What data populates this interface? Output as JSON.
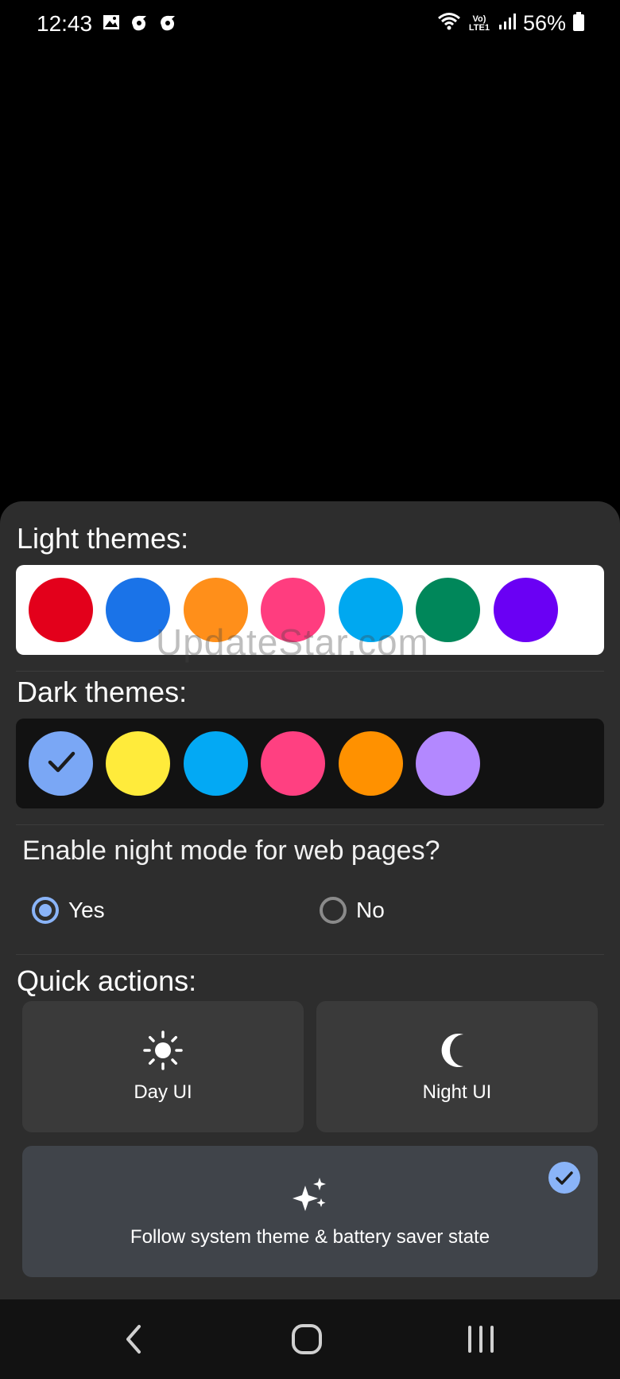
{
  "status_bar": {
    "time": "12:43",
    "battery": "56%",
    "network_label": "Vo) LTE1"
  },
  "light_themes": {
    "title": "Light themes:",
    "colors": [
      "#e3001b",
      "#1a73e8",
      "#ff8f1a",
      "#ff3d7f",
      "#00a8f0",
      "#00875a",
      "#6a00f4"
    ]
  },
  "dark_themes": {
    "title": "Dark themes:",
    "colors": [
      "#7aa7f5",
      "#ffeb3b",
      "#03a9f4",
      "#ff4081",
      "#ff9100",
      "#b388ff"
    ],
    "selected_index": 0
  },
  "watermark": "UpdateStar.com",
  "night_mode": {
    "question": "Enable night mode for web pages?",
    "yes_label": "Yes",
    "no_label": "No",
    "selected": "Yes"
  },
  "quick_actions": {
    "title": "Quick actions:",
    "day_label": "Day UI",
    "night_label": "Night UI",
    "follow_label": "Follow system theme & battery saver state",
    "follow_selected": true
  },
  "colors": {
    "accent": "#8ab4f8",
    "sheet_bg": "#2d2d2d"
  }
}
